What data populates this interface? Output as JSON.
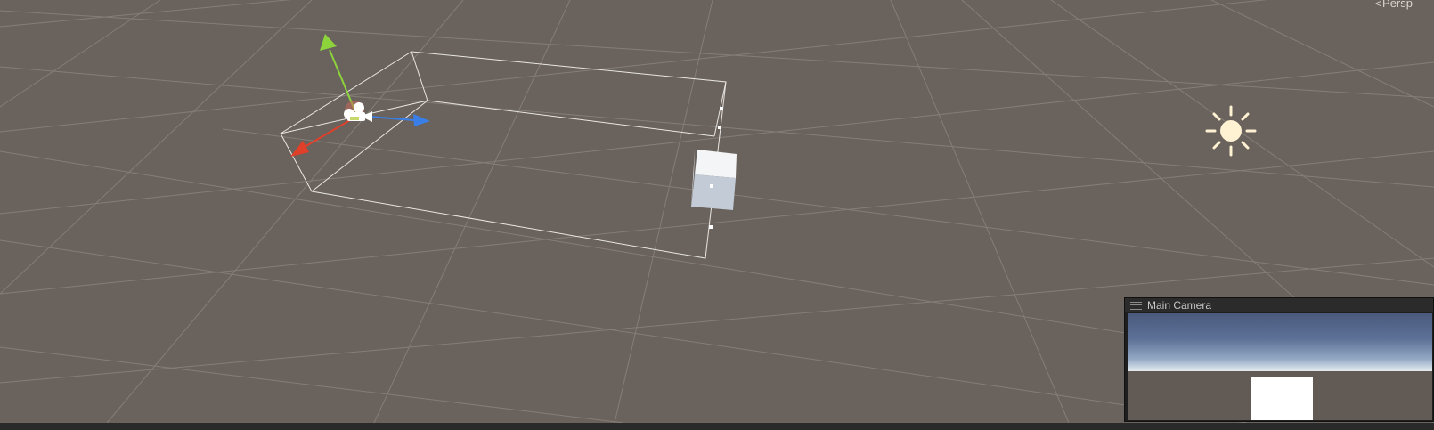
{
  "scene_view": {
    "projection_label": "Persp",
    "projection_arrow": "<"
  },
  "scene_objects": [
    {
      "name": "Main Camera",
      "kind": "camera",
      "selected": true
    },
    {
      "name": "Cube",
      "kind": "cube"
    },
    {
      "name": "Directional Light",
      "kind": "light"
    }
  ],
  "camera_preview": {
    "title": "Main Camera"
  },
  "colors": {
    "scene_background": "#6a625c",
    "grid_line": "#8a837d",
    "gizmo_x": "#e0402a",
    "gizmo_y": "#8cd33c",
    "gizmo_z": "#3a7ee8",
    "light_icon": "#fff2d2"
  }
}
